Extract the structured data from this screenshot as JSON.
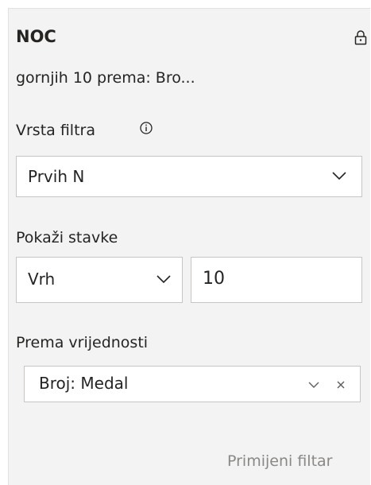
{
  "card": {
    "title": "NOC",
    "subtitle": "gornjih 10 prema: Bro..."
  },
  "filter_type": {
    "label": "Vrsta filtra",
    "selected": "Prvih N"
  },
  "show_items": {
    "label": "Pokaži stavke",
    "direction_selected": "Vrh",
    "count_value": "10"
  },
  "by_value": {
    "label": "Prema vrijednosti",
    "field": "Broj: Medal"
  },
  "apply_label": "Primijeni filtar",
  "icons": {
    "lock": "lock-icon",
    "info": "info-icon",
    "chevron": "chevron-down-icon",
    "remove": "close-icon"
  }
}
